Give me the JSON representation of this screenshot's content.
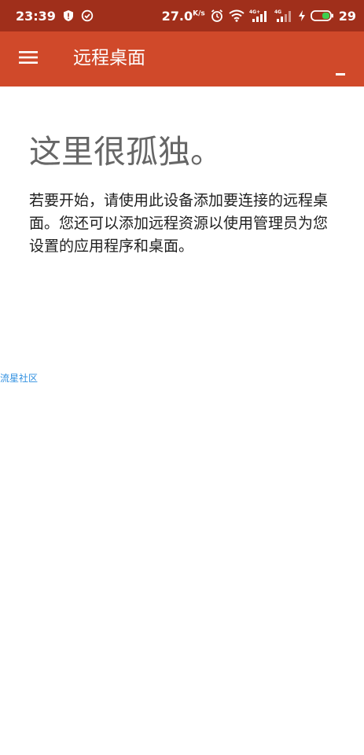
{
  "status_bar": {
    "time": "23:39",
    "network_speed": "27.0",
    "network_speed_unit": "K/s",
    "signal1_tag": "4G+",
    "signal2_tag": "4G",
    "battery_percent": "29",
    "icons": [
      "shield-icon",
      "check-circle-icon",
      "alarm-icon",
      "wifi-icon",
      "signal-icon",
      "signal-icon",
      "charging-icon",
      "battery-icon"
    ]
  },
  "app_bar": {
    "title": "远程桌面",
    "color": "#d0492a",
    "status_color": "#a02f1b"
  },
  "empty_state": {
    "title": "这里很孤独。",
    "description": "若要开始，请使用此设备添加要连接的远程桌面。您还可以添加远程资源以使用管理员为您设置的应用程序和桌面。"
  },
  "watermark": {
    "text": "流星社区"
  }
}
